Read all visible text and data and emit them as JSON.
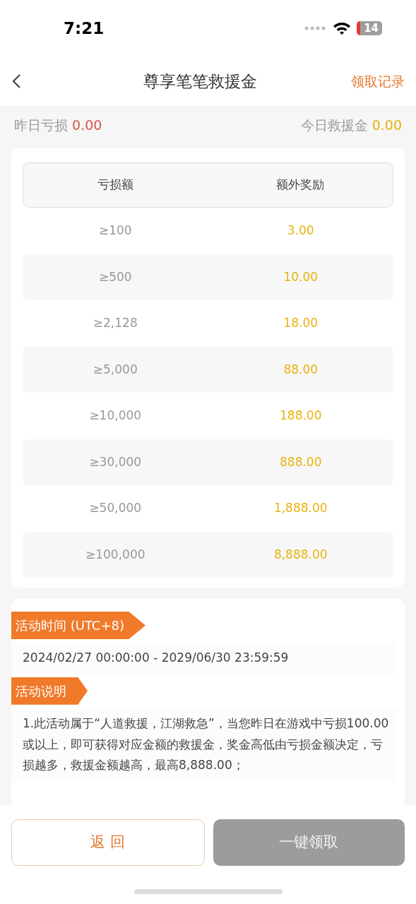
{
  "status_bar": {
    "time": "7:21",
    "battery": "14"
  },
  "nav": {
    "title": "尊享笔笔救援金",
    "action": "领取记录"
  },
  "summary": {
    "left_label": "昨日亏损",
    "left_value": "0.00",
    "right_label": "今日救援金",
    "right_value": "0.00"
  },
  "table": {
    "columns": [
      "亏损额",
      "额外奖励"
    ],
    "rows": [
      [
        "≥100",
        "3.00"
      ],
      [
        "≥500",
        "10.00"
      ],
      [
        "≥2,128",
        "18.00"
      ],
      [
        "≥5,000",
        "88.00"
      ],
      [
        "≥10,000",
        "188.00"
      ],
      [
        "≥30,000",
        "888.00"
      ],
      [
        "≥50,000",
        "1,888.00"
      ],
      [
        "≥100,000",
        "8,888.00"
      ]
    ]
  },
  "sections": [
    {
      "heading": "活动时间 (UTC+8)",
      "body": "2024/02/27 00:00:00 - 2029/06/30 23:59:59"
    },
    {
      "heading": "活动说明",
      "body": "1.此活动属于“人道救援，江湖救急”，当您昨日在游戏中亏损100.00或以上，即可获得对应金额的救援金，奖金高低由亏损金额决定，亏损越多，救援金额越高，最高8,888.00；"
    }
  ],
  "buttons": [
    {
      "label": "返 回",
      "kind": "outline",
      "disabled": false
    },
    {
      "label": "一键领取",
      "kind": "primary",
      "disabled": true
    }
  ]
}
